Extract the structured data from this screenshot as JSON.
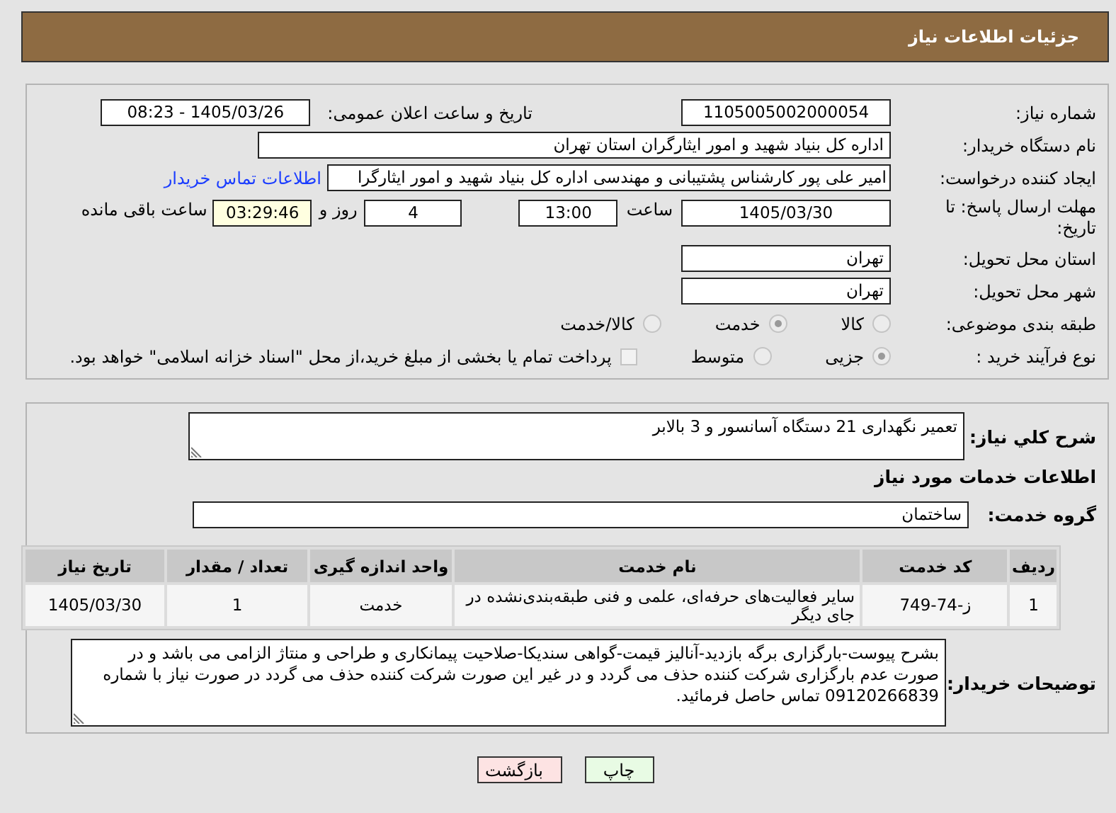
{
  "header": {
    "title": "جزئیات اطلاعات نیاز"
  },
  "need_number": {
    "label": "شماره نیاز:",
    "value": "1105005002000054"
  },
  "announce": {
    "label": "تاریخ و ساعت اعلان عمومی:",
    "value": "1405/03/26 - 08:23"
  },
  "buyer_org": {
    "label": "نام دستگاه خریدار:",
    "value": "اداره کل بنیاد شهید و امور ایثارگران استان تهران"
  },
  "requester": {
    "label": "ایجاد کننده درخواست:",
    "value": "امیر علی پور کارشناس پشتیبانی و مهندسی اداره کل بنیاد شهید و امور ایثارگرا",
    "link": "اطلاعات تماس خریدار"
  },
  "deadline": {
    "label": "مهلت ارسال پاسخ: تا تاریخ:",
    "date": "1405/03/30",
    "time_label": "ساعت",
    "time": "13:00",
    "days": "4",
    "days_label": "روز و",
    "remaining": "03:29:46",
    "remaining_label": "ساعت باقی مانده"
  },
  "province": {
    "label": "استان محل تحویل:",
    "value": "تهران"
  },
  "city": {
    "label": "شهر محل تحویل:",
    "value": "تهران"
  },
  "category": {
    "label": "طبقه بندی موضوعی:",
    "options": [
      {
        "label": "کالا",
        "selected": false
      },
      {
        "label": "خدمت",
        "selected": true
      },
      {
        "label": "کالا/خدمت",
        "selected": false
      }
    ]
  },
  "process": {
    "label": "نوع فرآیند خرید :",
    "options": [
      {
        "label": "جزیی",
        "selected": true
      },
      {
        "label": "متوسط",
        "selected": false
      }
    ],
    "payment": {
      "checked": false,
      "text": "پرداخت تمام یا بخشی از مبلغ خرید،از محل \"اسناد خزانه اسلامی\" خواهد بود."
    }
  },
  "description": {
    "label": "شرح كلي نياز:",
    "value": "تعمیر نگهداری 21 دستگاه آسانسور و 3 بالابر"
  },
  "services_heading": "اطلاعات خدمات مورد نياز",
  "service_group": {
    "label": "گروه خدمت:",
    "value": "ساختمان"
  },
  "table": {
    "columns": [
      "ردیف",
      "کد خدمت",
      "نام خدمت",
      "واحد اندازه گیری",
      "تعداد / مقدار",
      "تاریخ نیاز"
    ],
    "rows": [
      [
        "1",
        "ز-74-749",
        "سایر فعالیت‌های حرفه‌ای، علمی و فنی طبقه‌بندی‌نشده در جای دیگر",
        "خدمت",
        "1",
        "1405/03/30"
      ]
    ]
  },
  "buyer_notes": {
    "label": "توضیحات خریدار:",
    "value": "بشرح پیوست-بارگزاری برگه بازدید-آنالیز قیمت-گواهی سندیکا-صلاحیت پیمانکاری و طراحی و منتاژ الزامی می باشد و در صورت عدم بارگزاری شرکت کننده حذف می گردد و در غیر این صورت شرکت کننده حذف می گردد در صورت نیاز با شماره 09120266839 تماس حاصل فرمائید."
  },
  "buttons": [
    {
      "label": "چاپ",
      "kind": "print"
    },
    {
      "label": "بازگشت",
      "kind": "back"
    }
  ]
}
